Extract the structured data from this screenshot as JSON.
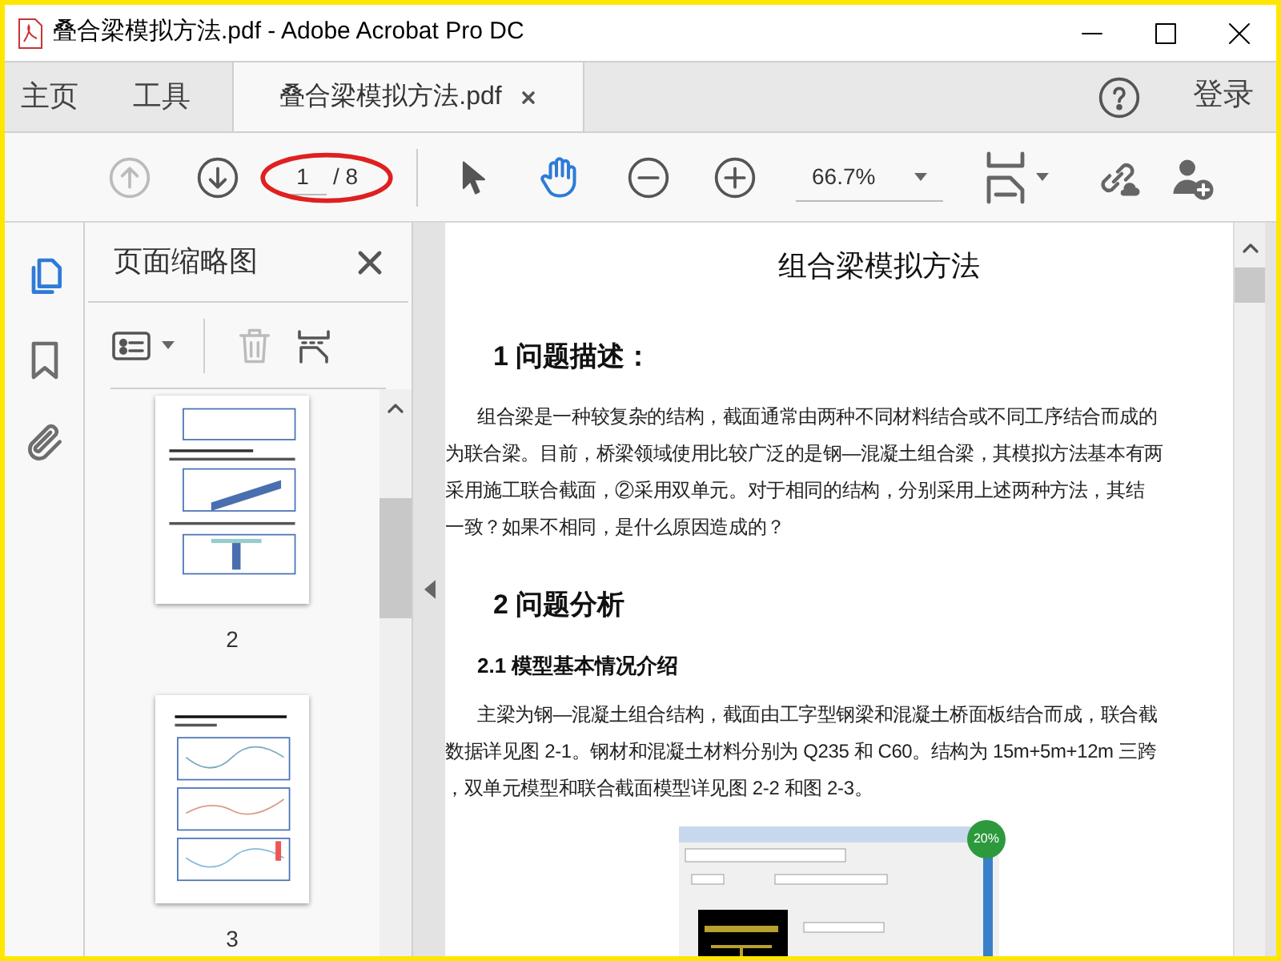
{
  "window": {
    "title": "叠合梁模拟方法.pdf - Adobe Acrobat Pro DC"
  },
  "tabs": [
    {
      "label": "主页",
      "selected": false
    },
    {
      "label": "工具",
      "selected": false
    },
    {
      "label": "叠合梁模拟方法.pdf",
      "selected": true
    }
  ],
  "sign_in": "登录",
  "toolbar": {
    "prev_disabled": true,
    "page": "1",
    "page_total": "/ 8",
    "zoom": "66.7%",
    "circled": true
  },
  "side_rail": [
    {
      "kind": "pages",
      "selected": true
    },
    {
      "kind": "bookmarks",
      "selected": false
    },
    {
      "kind": "attachments",
      "selected": false
    }
  ],
  "panel": {
    "title": "页面缩略图",
    "thumbnails": [
      {
        "label": "2",
        "kind": "figures"
      },
      {
        "label": "3",
        "kind": "charts"
      }
    ]
  },
  "document": {
    "title": "组合梁模拟方法",
    "blocks": [
      {
        "kind": "heading",
        "text": "1 问题描述："
      },
      {
        "kind": "paragraph",
        "lines": [
          "组合梁是一种较复杂的结构，截面通常由两种不同材料结合或不同工序结合而成的",
          "为联合梁。目前，桥梁领域使用比较广泛的是钢—混凝土组合梁，其模拟方法基本有两",
          "采用施工联合截面，②采用双单元。对于相同的结构，分别采用上述两种方法，其结",
          "一致？如果不相同，是什么原因造成的？"
        ]
      },
      {
        "kind": "heading",
        "text": "2 问题分析"
      },
      {
        "kind": "subheading",
        "text": "2.1 模型基本情况介绍"
      },
      {
        "kind": "paragraph",
        "lines": [
          "主梁为钢—混凝土组合结构，截面由工字型钢梁和混凝土桥面板结合而成，联合截",
          "数据详见图 2-1。钢材和混凝土材料分别为 Q235 和 C60。结构为 15m+5m+12m 三跨",
          "，双单元模型和联合截面模型详见图 2-2 和图 2-3。"
        ]
      },
      {
        "kind": "figure",
        "badge": "20%"
      }
    ]
  }
}
